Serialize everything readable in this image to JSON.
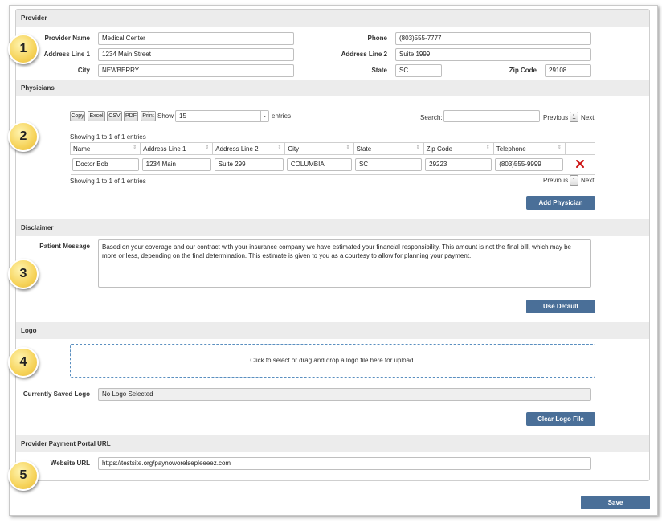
{
  "provider": {
    "header": "Provider",
    "name_label": "Provider Name",
    "name_value": "Medical Center",
    "addr1_label": "Address Line 1",
    "addr1_value": "1234 Main Street",
    "city_label": "City",
    "city_value": "NEWBERRY",
    "phone_label": "Phone",
    "phone_value": "(803)555-7777",
    "addr2_label": "Address Line 2",
    "addr2_value": "Suite 1999",
    "state_label": "State",
    "state_value": "SC",
    "zip_label": "Zip Code",
    "zip_value": "29108"
  },
  "physicians": {
    "header": "Physicians",
    "buttons": [
      "Copy",
      "Excel",
      "CSV",
      "PDF",
      "Print"
    ],
    "show_label": "Show",
    "show_value": "15",
    "entries_label": "entries",
    "search_label": "Search:",
    "search_value": "",
    "previous": "Previous",
    "page": "1",
    "next": "Next",
    "showing_top": "Showing 1 to 1 of 1 entries",
    "showing_bottom": "Showing 1 to 1 of 1 entries",
    "columns": [
      "Name",
      "Address Line 1",
      "Address Line 2",
      "City",
      "State",
      "Zip Code",
      "Telephone"
    ],
    "rows": [
      [
        "Doctor Bob",
        "1234 Main",
        "Suite 299",
        "COLUMBIA",
        "SC",
        "29223",
        "(803)555-9999"
      ]
    ],
    "add_button": "Add Physician"
  },
  "disclaimer": {
    "header": "Disclaimer",
    "message_label": "Patient Message",
    "message_value": "Based on your coverage and our contract with your insurance company we have estimated your financial responsibility.  This amount is not the final bill, which may be more or less, depending on the final determination.  This estimate is given to you as a courtesy to allow for planning your payment.",
    "default_button": "Use Default"
  },
  "logo": {
    "header": "Logo",
    "dropzone_text": "Click to select or drag and drop a logo file here for upload.",
    "saved_label": "Currently Saved Logo",
    "saved_value": "No Logo Selected",
    "clear_button": "Clear Logo File"
  },
  "portal": {
    "header": "Provider Payment Portal URL",
    "url_label": "Website URL",
    "url_value": "https://testsite.org/paynoworelsepleeeez.com"
  },
  "save_button": "Save",
  "badges": [
    "1",
    "2",
    "3",
    "4",
    "5"
  ],
  "colors": {
    "accent": "#4a6f98",
    "section_bg": "#ececec",
    "delete_icon": "#cc1111",
    "badge": "#f6d35a"
  }
}
